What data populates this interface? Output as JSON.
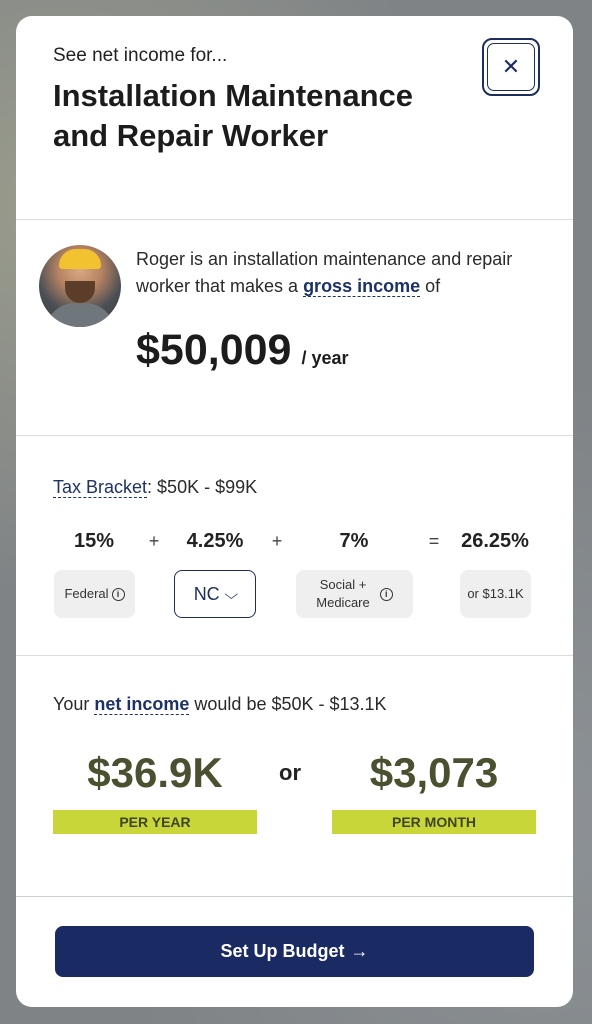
{
  "header": {
    "eyebrow": "See net income for...",
    "title": "Installation Maintenance and Repair Worker",
    "close_glyph": "✕"
  },
  "profile": {
    "bio_start": "Roger is an installation maintenance and repair worker that makes a ",
    "bio_link": "gross income",
    "bio_end": " of",
    "gross_amount": "$50,009",
    "gross_period": "/ year"
  },
  "tax": {
    "bracket_link": "Tax Bracket",
    "bracket_value": ": $50K - $99K",
    "federal_rate": "15%",
    "state_rate": "4.25%",
    "social_rate": "7%",
    "total_rate": "26.25%",
    "plus": "+",
    "equals": "=",
    "federal_label": "Federal",
    "state_selected": "NC",
    "social_label_1": "Social +",
    "social_label_2": "Medicare",
    "total_label": "or $13.1K",
    "info_glyph": "i",
    "chevron_glyph": "⌵"
  },
  "net": {
    "line_start": "Your ",
    "line_link": "net income",
    "line_end": " would be $50K - $13.1K",
    "yearly_amount": "$36.9K",
    "or": "or",
    "monthly_amount": "$3,073",
    "yearly_label": "PER YEAR",
    "monthly_label": "PER MONTH"
  },
  "cta": {
    "label": "Set Up Budget",
    "arrow": "→"
  },
  "colors": {
    "navy": "#1a2b63",
    "olive_text": "#4a5130",
    "lime_tag": "#c9d63a"
  }
}
